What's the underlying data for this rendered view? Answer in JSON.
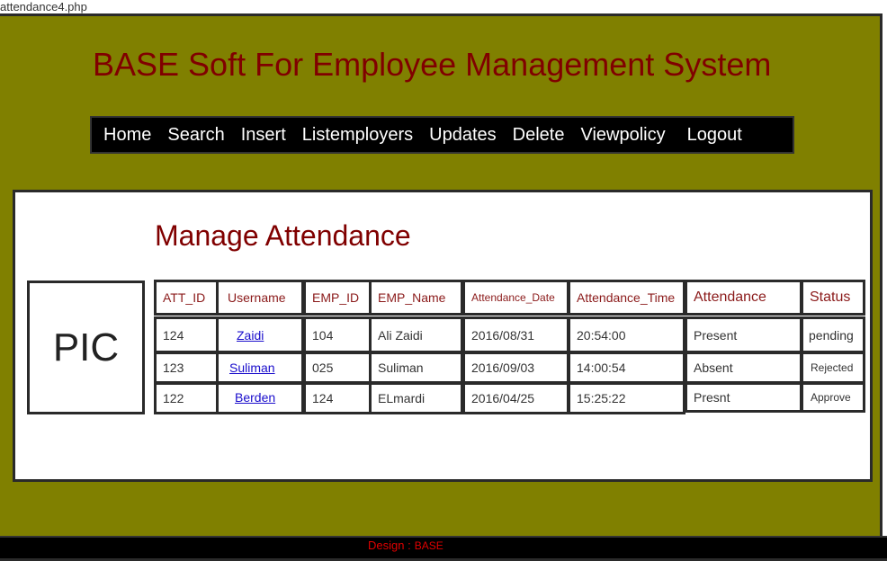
{
  "browser": {
    "url": "attendance4.php"
  },
  "header": {
    "title": "BASE Soft For Employee Management System"
  },
  "nav": {
    "items": [
      {
        "label": "Home"
      },
      {
        "label": "Search"
      },
      {
        "label": "Insert"
      },
      {
        "label": "Listemployers"
      },
      {
        "label": "Updates"
      },
      {
        "label": "Delete"
      },
      {
        "label": "Viewpolicy"
      },
      {
        "label": "Logout"
      }
    ]
  },
  "main": {
    "heading": "Manage Attendance",
    "pic_label": "PIC",
    "table": {
      "columns": [
        "ATT_ID",
        "Username",
        "EMP_ID",
        "EMP_Name",
        "Attendance_Date",
        "Attendance_Time",
        "Attendance",
        "Status"
      ],
      "rows": [
        {
          "att_id": "124",
          "username": "Zaidi",
          "emp_id": "104",
          "emp_name": "Ali Zaidi",
          "date": "2016/08/31",
          "time": "20:54:00",
          "attendance": "Present",
          "status": "pending"
        },
        {
          "att_id": "123",
          "username": "Suliman",
          "emp_id": "025",
          "emp_name": "Suliman",
          "date": "2016/09/03",
          "time": "14:00:54",
          "attendance": "Absent",
          "status": "Rejected"
        },
        {
          "att_id": "122",
          "username": "Berden",
          "emp_id": "124",
          "emp_name": "ELmardi",
          "date": "2016/04/25",
          "time": "15:25:22",
          "attendance": "Presnt",
          "status": "Approve"
        }
      ]
    }
  },
  "footer": {
    "design_label": "Design :",
    "brand": "BASE"
  },
  "colors": {
    "page_background": "#808000",
    "title_color": "#800000",
    "nav_background": "#000000",
    "nav_text": "#ffffff",
    "header_cell_text": "#8b1a1a",
    "link_color": "#1a0dcc",
    "footer_text": "#e00000"
  }
}
